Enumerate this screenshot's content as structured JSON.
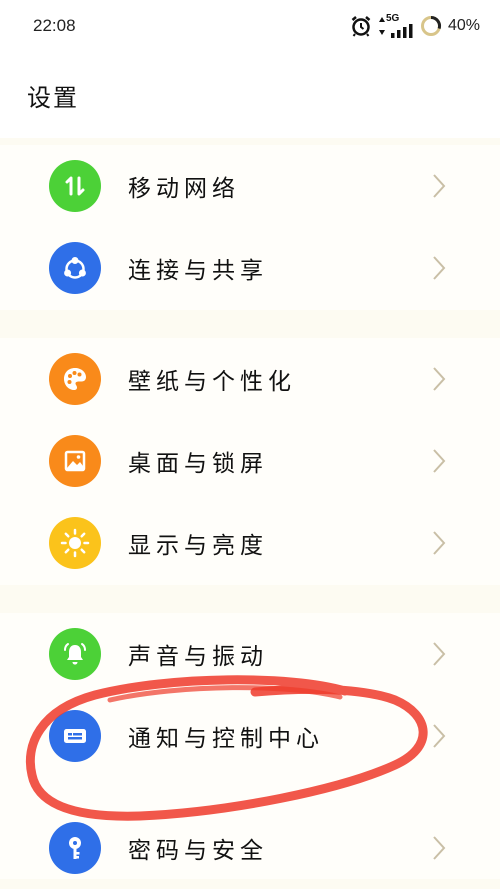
{
  "status_bar": {
    "time": "22:08",
    "network": "5G",
    "battery": "40%"
  },
  "header": {
    "title": "设置"
  },
  "settings": [
    {
      "label": "移动网络",
      "icon": "mobile-network-icon",
      "color": "#4cd137"
    },
    {
      "label": "连接与共享",
      "icon": "share-icon",
      "color": "#2f6fe8"
    },
    {
      "label": "壁纸与个性化",
      "icon": "palette-icon",
      "color": "#f98a1a"
    },
    {
      "label": "桌面与锁屏",
      "icon": "picture-icon",
      "color": "#f98a1a"
    },
    {
      "label": "显示与亮度",
      "icon": "sun-icon",
      "color": "#fbc31b"
    },
    {
      "label": "声音与振动",
      "icon": "bell-icon",
      "color": "#4cd137"
    },
    {
      "label": "通知与控制中心",
      "icon": "notification-card-icon",
      "color": "#2f6fe8"
    },
    {
      "label": "密码与安全",
      "icon": "key-icon",
      "color": "#2f6fe8"
    }
  ],
  "annotation_color": "#ee3a2a"
}
